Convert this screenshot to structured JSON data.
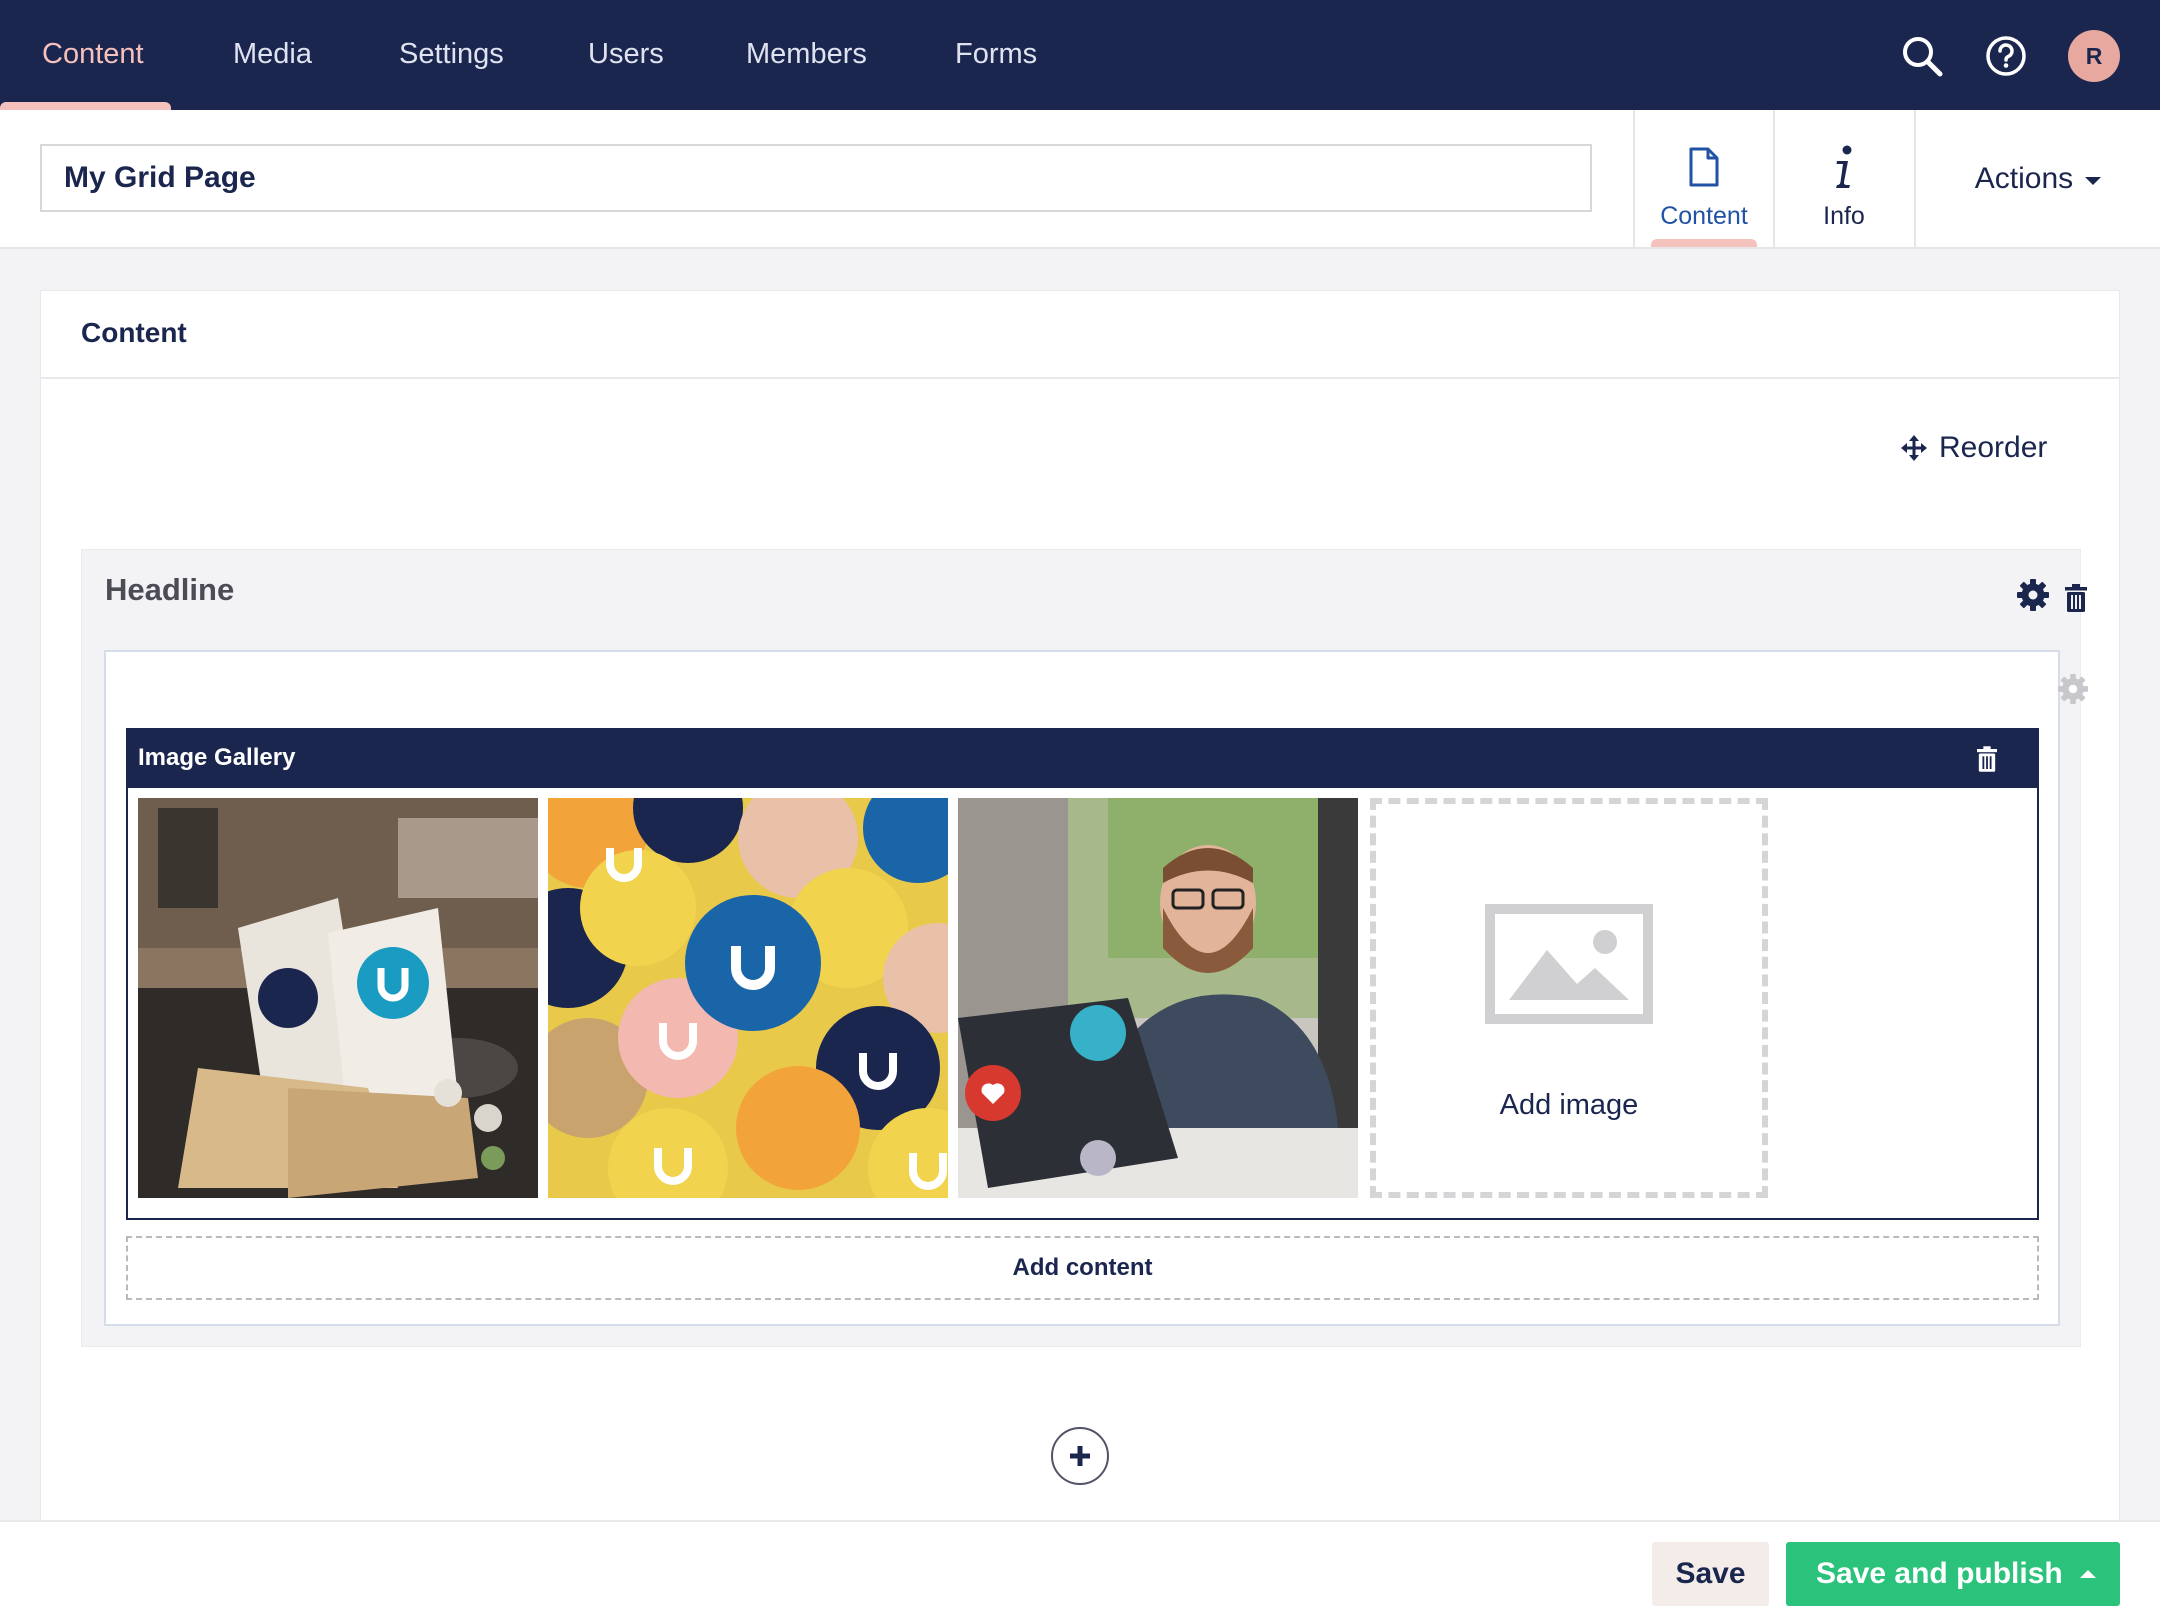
{
  "app": {
    "nav": [
      {
        "label": "Content",
        "active": true
      },
      {
        "label": "Media"
      },
      {
        "label": "Settings"
      },
      {
        "label": "Users"
      },
      {
        "label": "Members"
      },
      {
        "label": "Forms"
      }
    ],
    "user_initial": "R",
    "icons": [
      "search-icon",
      "help-icon"
    ]
  },
  "header": {
    "page_name": "My Grid Page",
    "tabs": [
      {
        "label": "Content",
        "icon": "document-icon",
        "active": true
      },
      {
        "label": "Info",
        "icon": "info-icon"
      }
    ],
    "actions_label": "Actions"
  },
  "panel": {
    "title": "Content",
    "reorder_label": "Reorder",
    "row": {
      "title": "Headline",
      "editor": {
        "title": "Image Gallery",
        "images": [
          "sticker-chairs",
          "sticker-pile",
          "person-laptop"
        ],
        "add_image_label": "Add image"
      },
      "add_content_label": "Add content"
    }
  },
  "footer": {
    "save_label": "Save",
    "publish_label": "Save and publish"
  },
  "colors": {
    "nav_bg": "#1b264f",
    "accent": "#f5c1bc",
    "publish": "#2bc37c",
    "save_bg": "#f3ece8"
  }
}
